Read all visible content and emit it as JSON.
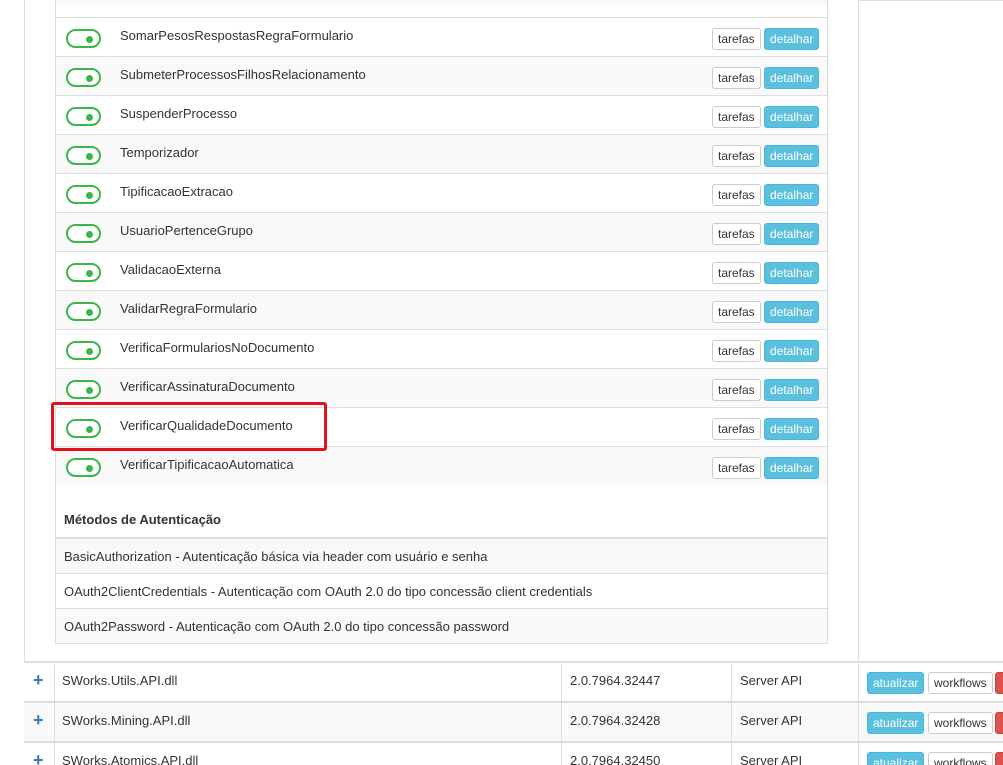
{
  "plugins": [
    {
      "name": "SomarPesosRespostasRegraFormulario",
      "enabled": true
    },
    {
      "name": "SubmeterProcessosFilhosRelacionamento",
      "enabled": true
    },
    {
      "name": "SuspenderProcesso",
      "enabled": true
    },
    {
      "name": "Temporizador",
      "enabled": true
    },
    {
      "name": "TipificacaoExtracao",
      "enabled": true
    },
    {
      "name": "UsuarioPertenceGrupo",
      "enabled": true
    },
    {
      "name": "ValidacaoExterna",
      "enabled": true
    },
    {
      "name": "ValidarRegraFormulario",
      "enabled": true
    },
    {
      "name": "VerificaFormulariosNoDocumento",
      "enabled": true
    },
    {
      "name": "VerificarAssinaturaDocumento",
      "enabled": true
    },
    {
      "name": "VerificarQualidadeDocumento",
      "enabled": true
    },
    {
      "name": "VerificarTipificacaoAutomatica",
      "enabled": true
    }
  ],
  "labels": {
    "tarefas": "tarefas",
    "detalhar": "detalhar",
    "atualizar": "atualizar",
    "workflows": "workflows",
    "plus": "+"
  },
  "auth": {
    "title": "Métodos de Autenticação",
    "methods": [
      "BasicAuthorization - Autenticação básica via header com usuário e senha",
      "OAuth2ClientCredentials - Autenticação com OAuth 2.0 do tipo concessão client credentials",
      "OAuth2Password - Autenticação com OAuth 2.0 do tipo concessão password"
    ]
  },
  "libraries": [
    {
      "name": "SWorks.Utils.API.dll",
      "version": "2.0.7964.32447",
      "type": "Server API"
    },
    {
      "name": "SWorks.Mining.API.dll",
      "version": "2.0.7964.32428",
      "type": "Server API"
    },
    {
      "name": "SWorks.Atomics.API.dll",
      "version": "2.0.7964.32450",
      "type": "Server API"
    }
  ],
  "colors": {
    "toggle_on": "#3cb54a",
    "info": "#5bc0de",
    "danger": "#d9534f",
    "highlight": "#e3111b",
    "link": "#337ab7"
  }
}
